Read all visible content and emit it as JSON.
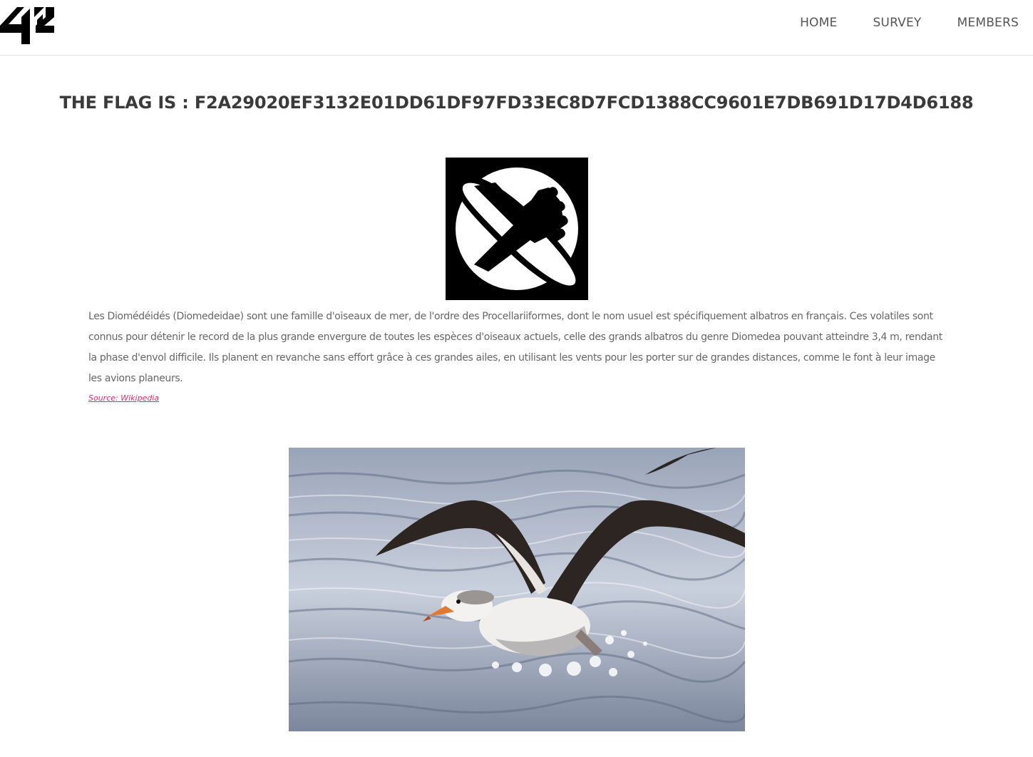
{
  "header": {
    "logo_icon": "42-logo",
    "nav": [
      {
        "label": "HOME"
      },
      {
        "label": "SURVEY"
      },
      {
        "label": "MEMBERS"
      }
    ]
  },
  "main": {
    "flag_title": "THE FLAG IS : F2A29020EF3132E01DD61DF97FD33EC8D7FCD1388CC9601E7DB691D17D4D6188",
    "emblem_icon": "hand-planet-emblem",
    "description": "Les Diomédéidés (Diomedeidae) sont une famille d'oiseaux de mer, de l'ordre des Procellariiformes, dont le nom usuel est spécifiquement albatros en français. Ces volatiles sont connus pour détenir le record de la plus grande envergure de toutes les espèces d'oiseaux actuels, celle des grands albatros du genre Diomedea pouvant atteindre 3,4 m, rendant la phase d'envol difficile. Ils planent en revanche sans effort grâce à ces grandes ailes, en utilisant les vents pour les porter sur de grandes distances, comme le font à leur image les avions planeurs.",
    "source_link": "Source: Wikipedia",
    "photo_subject": "albatross-taking-off"
  },
  "colors": {
    "link": "#d6336c",
    "text": "#666666",
    "heading": "#3a3a3a"
  }
}
